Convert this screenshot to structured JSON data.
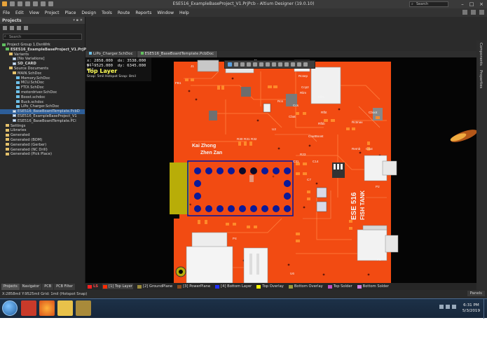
{
  "window": {
    "title": "ESE516_ExampleBaseProject_V1.PrjPcb - Altium Designer (19.0.10)",
    "search_placeholder": "Search"
  },
  "menu": [
    "File",
    "Edit",
    "View",
    "Project",
    "Place",
    "Design",
    "Tools",
    "Route",
    "Reports",
    "Window",
    "Help"
  ],
  "projects_panel": {
    "title": "Projects",
    "search_placeholder": "Search",
    "tree": [
      {
        "label": "Project Group 1.DsnWrk",
        "depth": 0,
        "icon": "proj",
        "bold": false,
        "selected": false
      },
      {
        "label": "ESE516_ExampleBaseProject_V1.PrjP",
        "depth": 1,
        "icon": "proj",
        "bold": true,
        "selected": false
      },
      {
        "label": "Variants",
        "depth": 2,
        "icon": "folder",
        "bold": false,
        "selected": false
      },
      {
        "label": "[No Variations]",
        "depth": 3,
        "icon": "doc",
        "bold": false,
        "selected": false
      },
      {
        "label": "SD_CARD",
        "depth": 3,
        "icon": "doc",
        "bold": true,
        "selected": false
      },
      {
        "label": "Source Documents",
        "depth": 2,
        "icon": "folder",
        "bold": false,
        "selected": false
      },
      {
        "label": "MAIN.SchDoc",
        "depth": 3,
        "icon": "folder",
        "bold": false,
        "selected": false
      },
      {
        "label": "Memory.SchDoc",
        "depth": 4,
        "icon": "sch",
        "bold": false,
        "selected": false
      },
      {
        "label": "MCU.SchDoc",
        "depth": 4,
        "icon": "sch",
        "bold": false,
        "selected": false
      },
      {
        "label": "FTDI.SchDoc",
        "depth": 4,
        "icon": "sch",
        "bold": false,
        "selected": false
      },
      {
        "label": "motordriver.SchDoc",
        "depth": 4,
        "icon": "sch",
        "bold": false,
        "selected": false
      },
      {
        "label": "Boost.schdoc",
        "depth": 4,
        "icon": "sch",
        "bold": false,
        "selected": false
      },
      {
        "label": "Buck.schdoc",
        "depth": 4,
        "icon": "sch",
        "bold": false,
        "selected": false
      },
      {
        "label": "LiPo_Charger.SchDoc",
        "depth": 4,
        "icon": "sch",
        "bold": false,
        "selected": false
      },
      {
        "label": "ESE516_BaseBoardTemplate.PcbD",
        "depth": 3,
        "icon": "doc",
        "bold": false,
        "selected": true
      },
      {
        "label": "ESE516_ExampleBaseProject_V1",
        "depth": 3,
        "icon": "doc",
        "bold": false,
        "selected": false
      },
      {
        "label": "ESE516_BaseBoardTemplate.PCl",
        "depth": 3,
        "icon": "doc",
        "bold": false,
        "selected": false
      },
      {
        "label": "Settings",
        "depth": 1,
        "icon": "folder",
        "bold": false,
        "selected": false
      },
      {
        "label": "Libraries",
        "depth": 1,
        "icon": "folder",
        "bold": false,
        "selected": false
      },
      {
        "label": "Generated",
        "depth": 1,
        "icon": "folder",
        "bold": false,
        "selected": false
      },
      {
        "label": "Generated (BOM)",
        "depth": 1,
        "icon": "folder",
        "bold": false,
        "selected": false
      },
      {
        "label": "Generated (Gerber)",
        "depth": 1,
        "icon": "folder",
        "bold": false,
        "selected": false
      },
      {
        "label": "Generated (NC Drill)",
        "depth": 1,
        "icon": "folder",
        "bold": false,
        "selected": false
      },
      {
        "label": "Generated (Pick Place)",
        "depth": 1,
        "icon": "folder",
        "bold": false,
        "selected": false
      }
    ],
    "bottom_tabs": [
      "Projects",
      "Navigator",
      "PCB",
      "PCB Filter"
    ]
  },
  "doc_tabs": [
    {
      "label": "LiPo_Charger.SchDoc",
      "active": false,
      "icon": "sch"
    },
    {
      "label": "ESE516_BaseBoardTemplate.PcbDoc",
      "active": true,
      "icon": "pcb"
    }
  ],
  "hud": {
    "x": "x:  2858.000",
    "dx": "dx:  3538.000  mil",
    "y": "y:  9525.000",
    "dy": "dy:  6345.000  mil",
    "layer": "Top Layer",
    "snap": "Snap: 5mil Hotspot Snap: 8mil"
  },
  "board": {
    "silk_name1": "Kai Zhong",
    "silk_name2": "Zhen Zan",
    "silk_title1": "ESE 516",
    "silk_title2": "FISH TANK",
    "labels": [
      "J1",
      "FB1",
      "J6",
      "Rcsep",
      "Ccp2",
      "Rlim",
      "Clim",
      "Rfbt",
      "Rfbb",
      "Cboot",
      "Rctmax",
      "Remb",
      "Cout",
      "R30",
      "R31",
      "R32",
      "R23",
      "C31",
      "C14",
      "C7",
      "P2",
      "P3",
      "P4",
      "U6",
      "U2",
      "CoutBoost",
      "Cbat",
      "Ccs",
      "Rcs"
    ],
    "colors": {
      "copper": "#ff3300",
      "board": "#f24b12",
      "silk": "#f5f5f5",
      "pad_blue": "#0c1a99",
      "pad_yellow": "#b8ad08"
    }
  },
  "right_side_tabs": [
    "Components",
    "Properties"
  ],
  "layer_tabs": [
    {
      "label": "LS",
      "color": "#ff2020",
      "active": false
    },
    {
      "label": "[1] Top Layer",
      "color": "#ff2b00",
      "active": true
    },
    {
      "label": "[2] GroundPlane",
      "color": "#9a8a3a",
      "active": false
    },
    {
      "label": "[3] PowerPlane",
      "color": "#8b4a1c",
      "active": false
    },
    {
      "label": "[4] Bottom Layer",
      "color": "#2030ff",
      "active": false
    },
    {
      "label": "Top Overlay",
      "color": "#ffff00",
      "active": false
    },
    {
      "label": "Bottom Overlay",
      "color": "#9a9a3a",
      "active": false
    },
    {
      "label": "Top Solder",
      "color": "#c050c0",
      "active": false
    },
    {
      "label": "Bottom Solder",
      "color": "#d07de0",
      "active": false
    }
  ],
  "status": {
    "text": "X:2858mil Y:9525mil   Grid: 1mil     (Hotspot Snap)",
    "panels_label": "Panels"
  },
  "taskbar": {
    "time": "6:31 PM",
    "date": "5/3/2019"
  }
}
